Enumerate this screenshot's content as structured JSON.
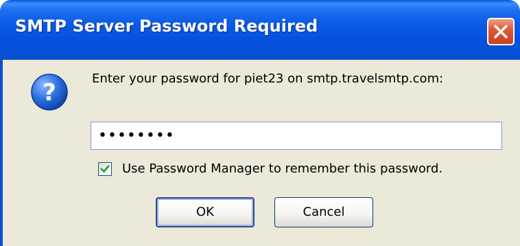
{
  "window": {
    "title": "SMTP Server Password Required"
  },
  "dialog": {
    "icon": "question-icon",
    "prompt": "Enter your password for piet23 on smtp.travelsmtp.com:",
    "password_value": "••••••••",
    "remember_label": "Use Password Manager to remember this password.",
    "remember_checked": true
  },
  "buttons": {
    "ok_label": "OK",
    "cancel_label": "Cancel"
  },
  "colors": {
    "titlebar": "#0a58e0",
    "client_background": "#ece9d8",
    "close_button": "#e05a38",
    "question_icon": "#1b5fd0",
    "checkmark": "#21a121"
  }
}
